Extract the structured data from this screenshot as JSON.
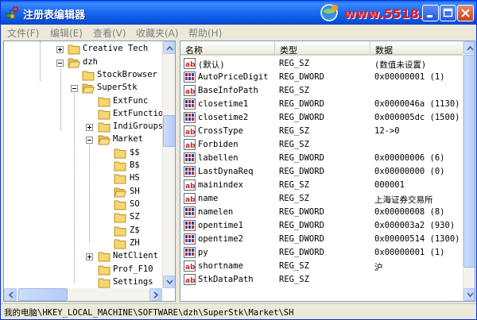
{
  "window": {
    "title": "注册表编辑器",
    "watermark": "www.5518…"
  },
  "menu": [
    {
      "label": "文件(F)"
    },
    {
      "label": "编辑(E)"
    },
    {
      "label": "查看(V)"
    },
    {
      "label": "收藏夹(A)"
    },
    {
      "label": "帮助(H)"
    }
  ],
  "tree": {
    "items": [
      {
        "label": "Creative Tech",
        "expander": "plus"
      },
      {
        "label": "dzh",
        "expander": "minus"
      },
      {
        "label": "StockBrowser",
        "expander": "none"
      },
      {
        "label": "SuperStk",
        "expander": "minus"
      },
      {
        "label": "ExtFunc",
        "expander": "none"
      },
      {
        "label": "ExtFunction",
        "expander": "none"
      },
      {
        "label": "IndiGroups",
        "expander": "plus"
      },
      {
        "label": "Market",
        "expander": "minus"
      },
      {
        "label": "$$",
        "expander": "none"
      },
      {
        "label": "B$",
        "expander": "none"
      },
      {
        "label": "HS",
        "expander": "none"
      },
      {
        "label": "SH",
        "expander": "none",
        "selected": true
      },
      {
        "label": "SO",
        "expander": "none"
      },
      {
        "label": "SZ",
        "expander": "none"
      },
      {
        "label": "Z$",
        "expander": "none"
      },
      {
        "label": "ZH",
        "expander": "none"
      },
      {
        "label": "NetClient",
        "expander": "plus"
      },
      {
        "label": "Prof_F10",
        "expander": "none"
      },
      {
        "label": "Settings",
        "expander": "none"
      }
    ]
  },
  "list": {
    "columns": {
      "name": "名称",
      "type": "类型",
      "data": "数据"
    },
    "rows": [
      {
        "icon": "string-value-icon",
        "name": "(默认)",
        "type": "REG_SZ",
        "data": "(数值未设置)"
      },
      {
        "icon": "dword-value-icon",
        "name": "AutoPriceDigit",
        "type": "REG_DWORD",
        "data": "0x00000001 (1)"
      },
      {
        "icon": "string-value-icon",
        "name": "BaseInfoPath",
        "type": "REG_SZ",
        "data": ""
      },
      {
        "icon": "dword-value-icon",
        "name": "closetime1",
        "type": "REG_DWORD",
        "data": "0x0000046a (1130)"
      },
      {
        "icon": "dword-value-icon",
        "name": "closetime2",
        "type": "REG_DWORD",
        "data": "0x000005dc (1500)"
      },
      {
        "icon": "string-value-icon",
        "name": "CrossType",
        "type": "REG_SZ",
        "data": "12->0"
      },
      {
        "icon": "string-value-icon",
        "name": "Forbiden",
        "type": "REG_SZ",
        "data": ""
      },
      {
        "icon": "dword-value-icon",
        "name": "labellen",
        "type": "REG_DWORD",
        "data": "0x00000006 (6)"
      },
      {
        "icon": "dword-value-icon",
        "name": "LastDynaReq",
        "type": "REG_DWORD",
        "data": "0x00000000 (0)"
      },
      {
        "icon": "string-value-icon",
        "name": "mainindex",
        "type": "REG_SZ",
        "data": "000001"
      },
      {
        "icon": "string-value-icon",
        "name": "name",
        "type": "REG_SZ",
        "data": "上海证券交易所"
      },
      {
        "icon": "dword-value-icon",
        "name": "namelen",
        "type": "REG_DWORD",
        "data": "0x00000008 (8)"
      },
      {
        "icon": "dword-value-icon",
        "name": "opentime1",
        "type": "REG_DWORD",
        "data": "0x000003a2 (930)"
      },
      {
        "icon": "dword-value-icon",
        "name": "opentime2",
        "type": "REG_DWORD",
        "data": "0x00000514 (1300)"
      },
      {
        "icon": "dword-value-icon",
        "name": "py",
        "type": "REG_DWORD",
        "data": "0x00000001 (1)"
      },
      {
        "icon": "string-value-icon",
        "name": "shortname",
        "type": "REG_SZ",
        "data": "沪"
      },
      {
        "icon": "string-value-icon",
        "name": "StkDataPath",
        "type": "REG_SZ",
        "data": ""
      }
    ]
  },
  "status": {
    "path": "我的电脑\\HKEY_LOCAL_MACHINE\\SOFTWARE\\dzh\\SuperStk\\Market\\SH"
  },
  "colors": {
    "titlebar": "#0A5FE8",
    "selection": "#316AC5",
    "folder": "#F5D76E",
    "string_icon": "#C0282D",
    "dword_icon": "#1F3FAF"
  }
}
